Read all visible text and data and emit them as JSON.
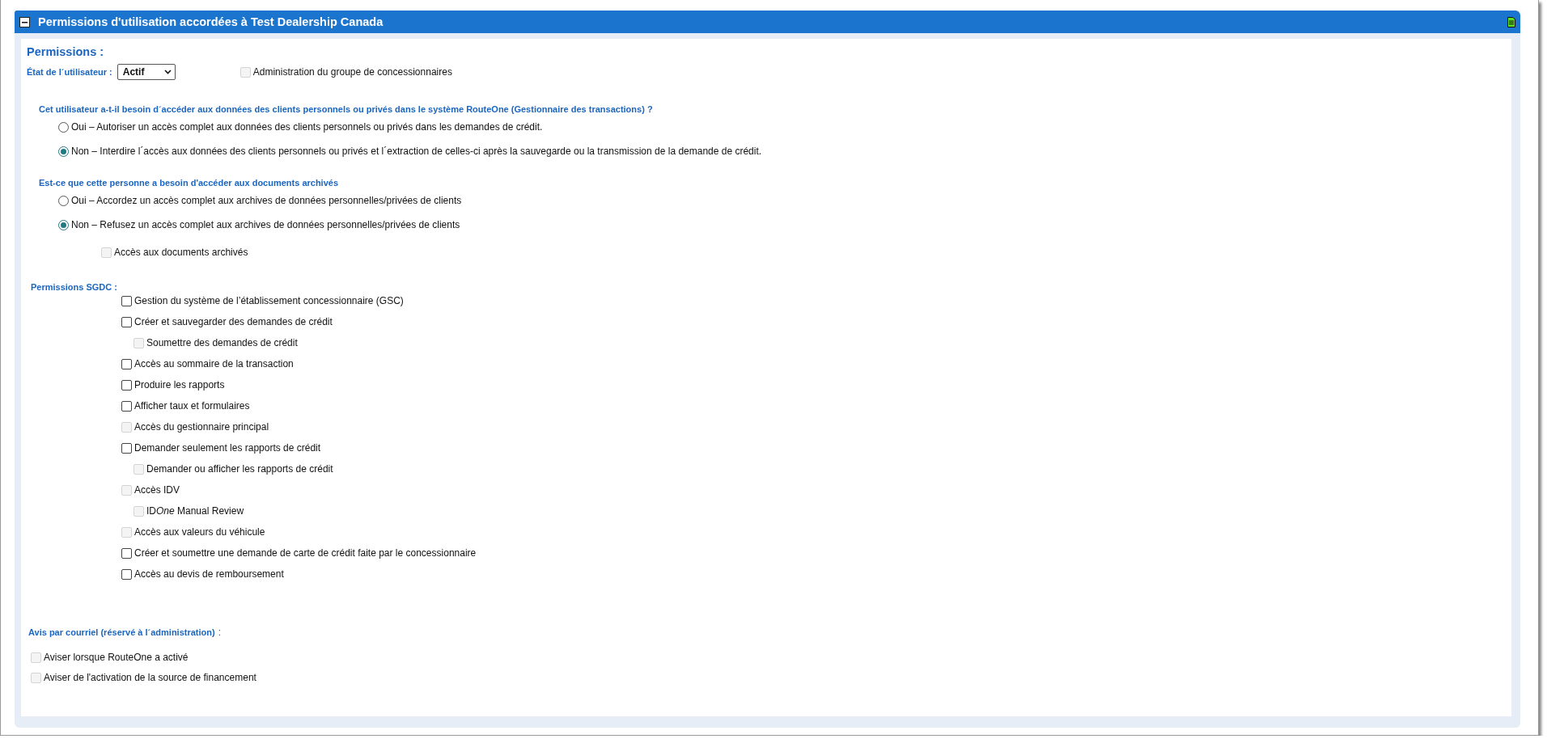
{
  "header": {
    "title": "Permissions d'utilisation accordées à Test Dealership Canada",
    "expanded": true
  },
  "permissions": {
    "title": "Permissions :",
    "user_status": {
      "label": "État de l´utilisateur :",
      "value": "Actif"
    },
    "group_admin": {
      "label": "Administration du groupe de concessionnaires",
      "checked": false,
      "disabled": true
    }
  },
  "questions": [
    {
      "title": "Cet utilisateur a-t-il besoin d´accéder aux données des clients personnels ou privés dans le système RouteOne (Gestionnaire des transactions) ?",
      "options": [
        {
          "label": "Oui – Autoriser un accès complet aux données des clients personnels ou privés dans les demandes de crédit.",
          "selected": false
        },
        {
          "label": "Non – Interdire l´accès aux données des clients personnels ou privés et l´extraction de celles-ci après la sauvegarde ou la transmission de la demande de crédit.",
          "selected": true
        }
      ]
    },
    {
      "title": "Est-ce que cette personne a besoin d'accéder aux documents archivés",
      "options": [
        {
          "label": "Oui – Accordez un accès complet aux archives de données personnelles/privées de clients",
          "selected": false
        },
        {
          "label": "Non – Refusez un accès complet aux archives de données personnelles/privées de clients",
          "selected": true
        }
      ],
      "extras": [
        {
          "label": "Accès aux documents archivés",
          "checked": false,
          "disabled": true
        }
      ]
    }
  ],
  "sgdc": {
    "title": "Permissions SGDC :",
    "items": [
      {
        "label": "Gestion du système de l’établissement concessionnaire (GSC)",
        "checked": false,
        "disabled": false
      },
      {
        "label": "Créer et sauvegarder des demandes de crédit",
        "checked": false,
        "disabled": false,
        "children": [
          {
            "label": "Soumettre des demandes de crédit",
            "checked": false,
            "disabled": true
          }
        ]
      },
      {
        "label": "Accès au sommaire de la transaction",
        "checked": false,
        "disabled": false
      },
      {
        "label": "Produire les rapports",
        "checked": false,
        "disabled": false
      },
      {
        "label": "Afficher taux et formulaires",
        "checked": false,
        "disabled": false
      },
      {
        "label": "Accès du gestionnaire principal",
        "checked": false,
        "disabled": true
      },
      {
        "label": "Demander seulement les rapports de crédit",
        "checked": false,
        "disabled": false,
        "children": [
          {
            "label": "Demander ou afficher les rapports de crédit",
            "checked": false,
            "disabled": true
          }
        ]
      },
      {
        "label": "Accès IDV",
        "checked": false,
        "disabled": true,
        "children": [
          {
            "label_parts": [
              {
                "text": "ID",
                "italic": false
              },
              {
                "text": "One",
                "italic": true
              },
              {
                "text": " Manual Review",
                "italic": false
              }
            ],
            "checked": false,
            "disabled": true
          }
        ]
      },
      {
        "label": "Accès aux valeurs du véhicule",
        "checked": false,
        "disabled": true
      },
      {
        "label": "Créer et soumettre une demande de carte de crédit faite par le concessionnaire",
        "checked": false,
        "disabled": false
      },
      {
        "label": "Accès au devis de remboursement",
        "checked": false,
        "disabled": false
      }
    ]
  },
  "email": {
    "title": "Avis par courriel (réservé à l´administration)",
    "colon": ":",
    "items": [
      {
        "label": "Aviser lorsque RouteOne a activé",
        "checked": false,
        "disabled": true
      },
      {
        "label": "Aviser de l'activation de la source de financement",
        "checked": false,
        "disabled": true
      }
    ]
  }
}
